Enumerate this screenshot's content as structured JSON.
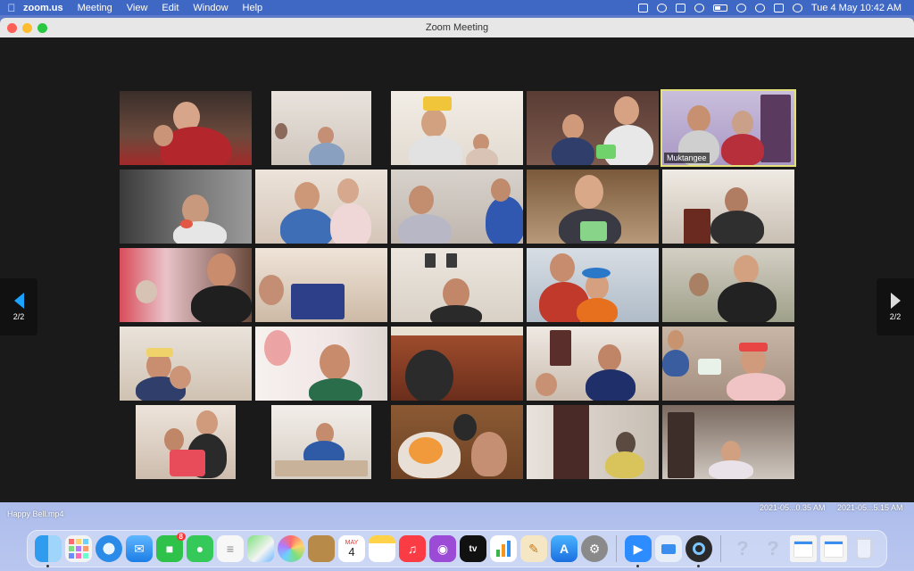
{
  "menubar": {
    "apple_icon": "apple-icon",
    "app_name": "zoom.us",
    "menus": [
      "Meeting",
      "View",
      "Edit",
      "Window",
      "Help"
    ],
    "clock": "Tue 4 May  10:42 AM"
  },
  "window": {
    "title": "Zoom Meeting"
  },
  "gallery": {
    "page_indicator_left": "2/2",
    "page_indicator_right": "2/2",
    "active_participant": "Muktangee"
  },
  "desktop": {
    "file_label": "Happy Bell.mp4",
    "screenshot_label_1": "2021-05...0.35 AM",
    "screenshot_label_2": "2021-05...5.15 AM"
  },
  "dock": {
    "messages_badge": "8",
    "calendar_month": "MAY",
    "calendar_day": "4",
    "apple_tv_label": "tv"
  }
}
